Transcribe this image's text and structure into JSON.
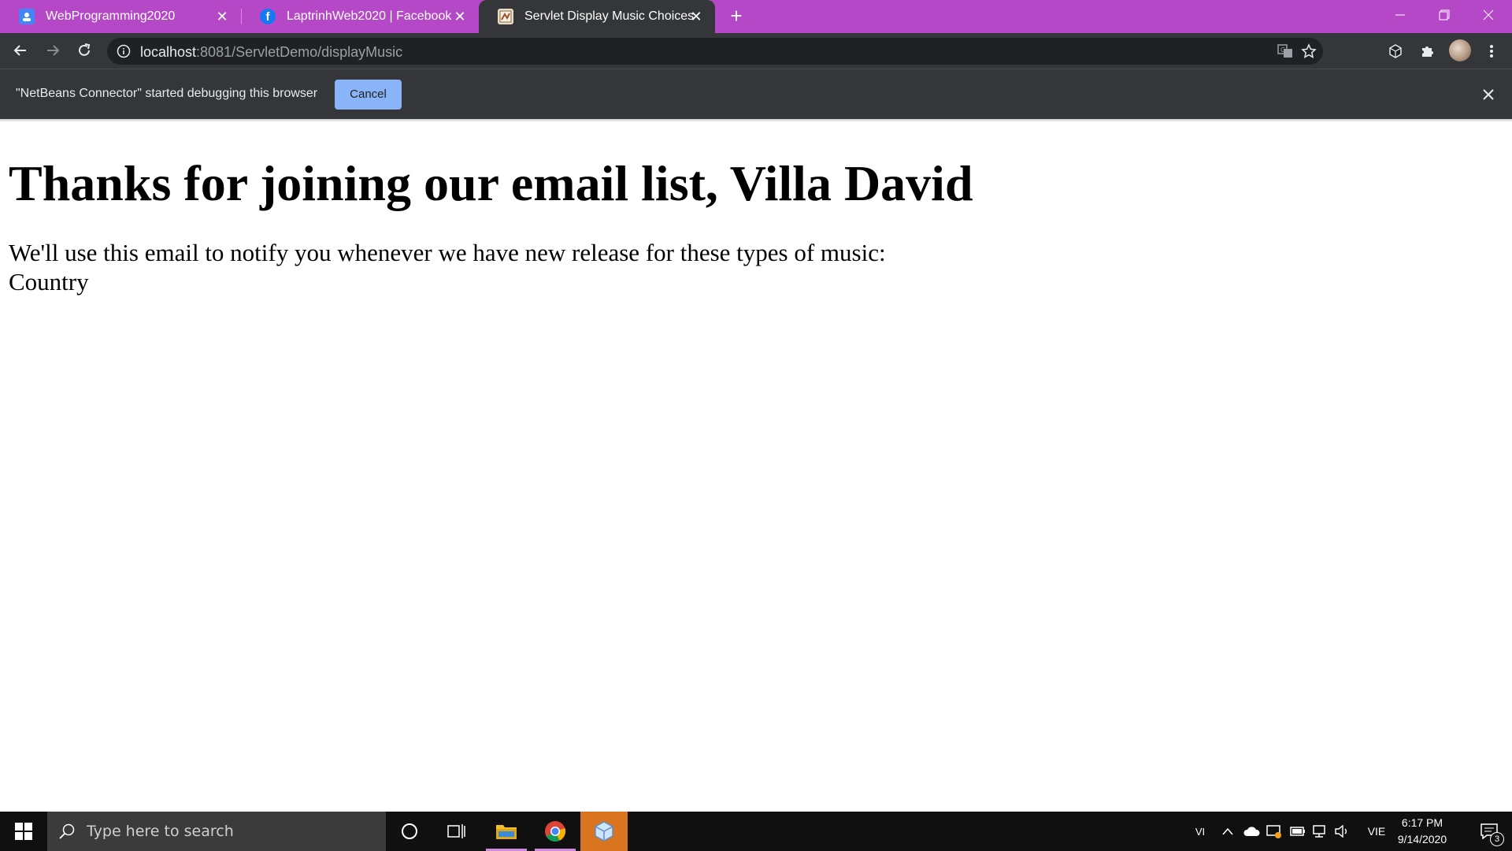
{
  "browser": {
    "tabs": [
      {
        "title": "WebProgramming2020",
        "favicon": "classroom-icon",
        "active": false
      },
      {
        "title": "LaptrinhWeb2020 | Facebook",
        "favicon": "facebook-icon",
        "active": false
      },
      {
        "title": "Servlet Display Music Choices Se",
        "favicon": "page-favicon",
        "active": true
      }
    ],
    "address": {
      "host": "localhost",
      "rest": ":8081/ServletDemo/displayMusic"
    },
    "infobar": {
      "message": "\"NetBeans Connector\" started debugging this browser",
      "cancel_label": "Cancel"
    },
    "colors": {
      "tabstrip": "#b548c6",
      "toolbar": "#35363a",
      "cancel_button": "#8ab4f8"
    }
  },
  "page": {
    "heading": "Thanks for joining our email list, Villa David",
    "notice": "We'll use this email to notify you whenever we have new release for these types of music:",
    "music_choice": "Country"
  },
  "taskbar": {
    "search_placeholder": "Type here to search",
    "input_indicator": "VI",
    "language": "VIE",
    "time": "6:17 PM",
    "date": "9/14/2020",
    "notification_count": "3"
  }
}
